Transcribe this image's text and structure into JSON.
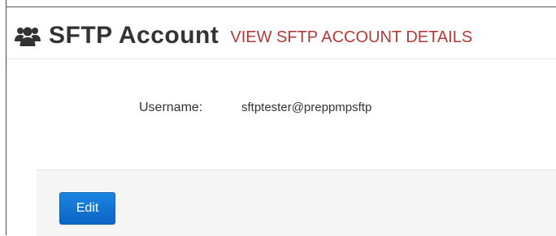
{
  "header": {
    "icon": "users-group-icon",
    "title": "SFTP Account",
    "subtitle": "VIEW SFTP ACCOUNT DETAILS"
  },
  "details": {
    "username_label": "Username:",
    "username_value": "sftptester@preppmpsftp"
  },
  "actions": {
    "edit_label": "Edit"
  },
  "colors": {
    "title": "#333333",
    "subtitle": "#b33a3a",
    "button": "#0b64c6",
    "panel": "#f5f5f5"
  }
}
